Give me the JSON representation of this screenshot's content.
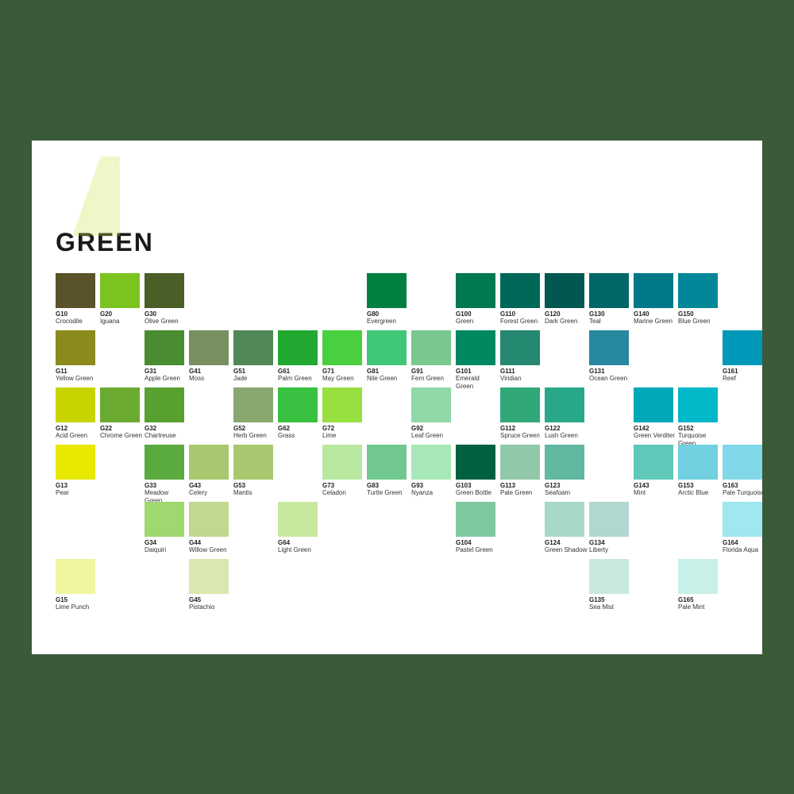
{
  "title": "GREEN",
  "colors": [
    {
      "code": "G10",
      "name": "Crocodile",
      "hex": "#5a5228",
      "row": 1,
      "col": 1
    },
    {
      "code": "G11",
      "name": "Yellow Green",
      "hex": "#8b8a1c",
      "row": 2,
      "col": 1
    },
    {
      "code": "G12",
      "name": "Acid Green",
      "hex": "#c8d400",
      "row": 3,
      "col": 1
    },
    {
      "code": "G13",
      "name": "Pear",
      "hex": "#e8e800",
      "row": 4,
      "col": 1
    },
    {
      "code": "G15",
      "name": "Lime Punch",
      "hex": "#f0f5a0",
      "row": 6,
      "col": 1
    },
    {
      "code": "G20",
      "name": "Iguana",
      "hex": "#7bc420",
      "row": 1,
      "col": 2
    },
    {
      "code": "G22",
      "name": "Chrome Green",
      "hex": "#6baa30",
      "row": 3,
      "col": 2
    },
    {
      "code": "G30",
      "name": "Olive Green",
      "hex": "#4a5e28",
      "row": 1,
      "col": 3
    },
    {
      "code": "G31",
      "name": "Apple Green",
      "hex": "#4a8c30",
      "row": 2,
      "col": 3
    },
    {
      "code": "G32",
      "name": "Chartreuse",
      "hex": "#58a030",
      "row": 3,
      "col": 3
    },
    {
      "code": "G33",
      "name": "Meadow Green",
      "hex": "#5aaa40",
      "row": 4,
      "col": 3
    },
    {
      "code": "G34",
      "name": "Daiquiri",
      "hex": "#a0d870",
      "row": 5,
      "col": 3
    },
    {
      "code": "G41",
      "name": "Moss",
      "hex": "#789060",
      "row": 2,
      "col": 4
    },
    {
      "code": "G43",
      "name": "Celery",
      "hex": "#a8c870",
      "row": 4,
      "col": 4
    },
    {
      "code": "G44",
      "name": "Willow Green",
      "hex": "#c0d890",
      "row": 5,
      "col": 4
    },
    {
      "code": "G45",
      "name": "Pistachio",
      "hex": "#d8e8b0",
      "row": 6,
      "col": 4
    },
    {
      "code": "G51",
      "name": "Jade",
      "hex": "#508858",
      "row": 2,
      "col": 5
    },
    {
      "code": "G52",
      "name": "Herb Green",
      "hex": "#88a870",
      "row": 3,
      "col": 5
    },
    {
      "code": "G53",
      "name": "Mantis",
      "hex": "#a8c870",
      "row": 4,
      "col": 5
    },
    {
      "code": "G61",
      "name": "Palm Green",
      "hex": "#20a830",
      "row": 2,
      "col": 6
    },
    {
      "code": "G62",
      "name": "Grass",
      "hex": "#38c040",
      "row": 3,
      "col": 6
    },
    {
      "code": "G64",
      "name": "Light Green",
      "hex": "#c8e8a0",
      "row": 5,
      "col": 6
    },
    {
      "code": "G71",
      "name": "May Green",
      "hex": "#48d040",
      "row": 2,
      "col": 7
    },
    {
      "code": "G72",
      "name": "Lime",
      "hex": "#98e040",
      "row": 3,
      "col": 7
    },
    {
      "code": "G73",
      "name": "Celadon",
      "hex": "#b8e8a0",
      "row": 4,
      "col": 7
    },
    {
      "code": "G80",
      "name": "Evergreen",
      "hex": "#008040",
      "row": 1,
      "col": 8
    },
    {
      "code": "G81",
      "name": "Nile Green",
      "hex": "#40c878",
      "row": 2,
      "col": 8
    },
    {
      "code": "G83",
      "name": "Turtle Green",
      "hex": "#70c890",
      "row": 4,
      "col": 8
    },
    {
      "code": "G91",
      "name": "Fern Green",
      "hex": "#78c890",
      "row": 2,
      "col": 9
    },
    {
      "code": "G92",
      "name": "Leaf Green",
      "hex": "#90d8a8",
      "row": 3,
      "col": 9
    },
    {
      "code": "G93",
      "name": "Nyanza",
      "hex": "#a8e8b8",
      "row": 4,
      "col": 9
    },
    {
      "code": "G100",
      "name": "Green",
      "hex": "#007850",
      "row": 1,
      "col": 10
    },
    {
      "code": "G101",
      "name": "Emerald Green",
      "hex": "#008860",
      "row": 2,
      "col": 10
    },
    {
      "code": "G103",
      "name": "Green Bottle",
      "hex": "#006040",
      "row": 4,
      "col": 10
    },
    {
      "code": "G104",
      "name": "Pastel Green",
      "hex": "#80c8a0",
      "row": 5,
      "col": 10
    },
    {
      "code": "G110",
      "name": "Forest Green",
      "hex": "#006858",
      "row": 1,
      "col": 11
    },
    {
      "code": "G111",
      "name": "Viridian",
      "hex": "#258870",
      "row": 2,
      "col": 11
    },
    {
      "code": "G112",
      "name": "Spruce Green",
      "hex": "#30a878",
      "row": 3,
      "col": 11
    },
    {
      "code": "G113",
      "name": "Pale Green",
      "hex": "#90c8a8",
      "row": 4,
      "col": 11
    },
    {
      "code": "G120",
      "name": "Dark Green",
      "hex": "#005850",
      "row": 1,
      "col": 12
    },
    {
      "code": "G122",
      "name": "Lush Green",
      "hex": "#28a888",
      "row": 3,
      "col": 12
    },
    {
      "code": "G123",
      "name": "Seafoam",
      "hex": "#60b8a0",
      "row": 4,
      "col": 12
    },
    {
      "code": "G124",
      "name": "Green Shadow",
      "hex": "#a8d8c8",
      "row": 5,
      "col": 12
    },
    {
      "code": "G130",
      "name": "Teal",
      "hex": "#006868",
      "row": 1,
      "col": 13
    },
    {
      "code": "G131",
      "name": "Ocean Green",
      "hex": "#2888a0",
      "row": 2,
      "col": 13
    },
    {
      "code": "G134",
      "name": "Liberty",
      "hex": "#b0d8d0",
      "row": 5,
      "col": 13
    },
    {
      "code": "G135",
      "name": "Sea Mist",
      "hex": "#c8e8e0",
      "row": 6,
      "col": 13
    },
    {
      "code": "G140",
      "name": "Marine Green",
      "hex": "#007888",
      "row": 1,
      "col": 14
    },
    {
      "code": "G142",
      "name": "Green Verditer",
      "hex": "#00a8b8",
      "row": 3,
      "col": 14
    },
    {
      "code": "G143",
      "name": "Mint",
      "hex": "#60c8b8",
      "row": 4,
      "col": 14
    },
    {
      "code": "G150",
      "name": "Blue Green",
      "hex": "#008898",
      "row": 1,
      "col": 15
    },
    {
      "code": "G152",
      "name": "Turquoise Green",
      "hex": "#00b8c8",
      "row": 3,
      "col": 15
    },
    {
      "code": "G153",
      "name": "Arctic Blue",
      "hex": "#70d0e0",
      "row": 4,
      "col": 15
    },
    {
      "code": "G165",
      "name": "Pale Mint",
      "hex": "#c8f0e8",
      "row": 6,
      "col": 15
    },
    {
      "code": "G161",
      "name": "Reef",
      "hex": "#0098b8",
      "row": 2,
      "col": 16
    },
    {
      "code": "G163",
      "name": "Pale Turquoise",
      "hex": "#80d8e8",
      "row": 4,
      "col": 16
    },
    {
      "code": "G164",
      "name": "Florida Aqua",
      "hex": "#a0e8f0",
      "row": 5,
      "col": 16
    }
  ]
}
